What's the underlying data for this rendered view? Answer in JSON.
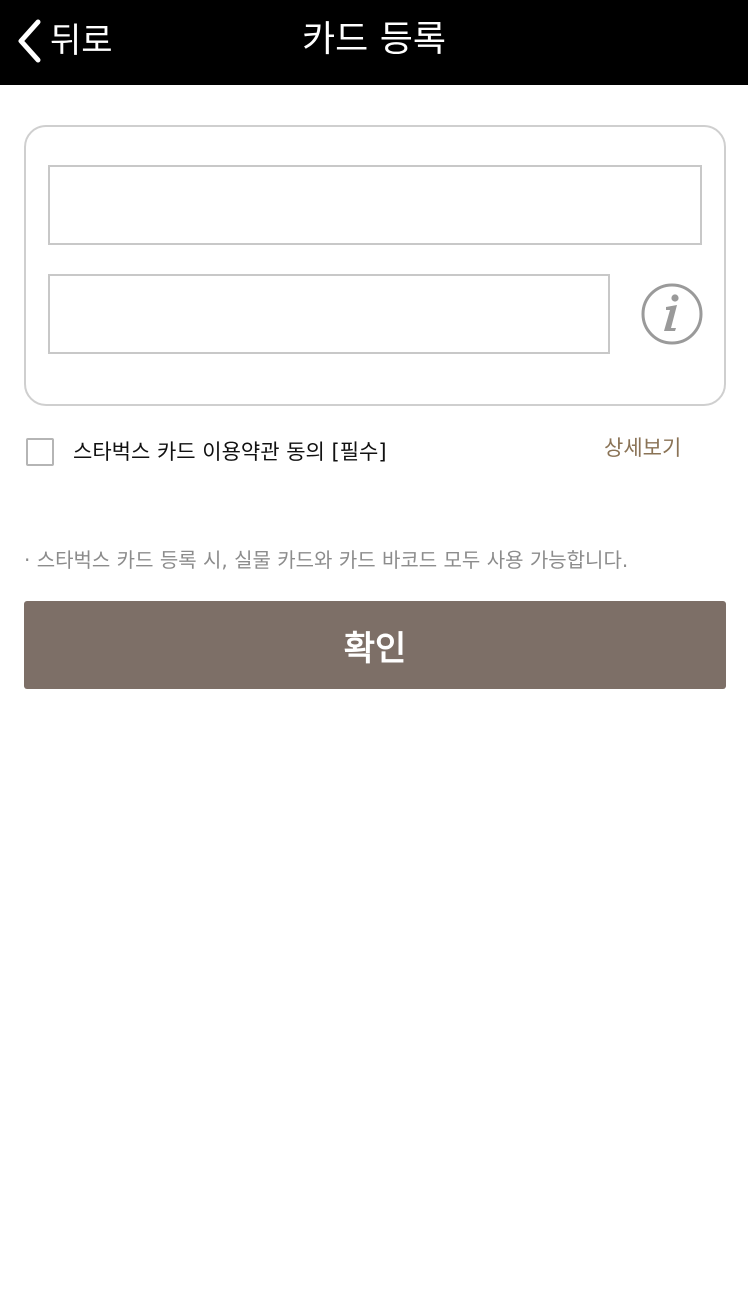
{
  "header": {
    "back_label": "뒤로",
    "title": "카드 등록",
    "back_icon": "chevron-left-icon"
  },
  "form": {
    "card_number": {
      "value": "",
      "placeholder": ""
    },
    "pin": {
      "value": "",
      "placeholder": ""
    },
    "info_icon": "info-icon"
  },
  "agreement": {
    "label": "스타벅스 카드 이용약관 동의 [필수]",
    "checked": false,
    "detail_label": "상세보기"
  },
  "notice": "· 스타벅스 카드 등록 시, 실물 카드와 카드 바코드 모두 사용 가능합니다.",
  "confirm_label": "확인",
  "colors": {
    "header_bg": "#000000",
    "accent_link": "#8a7356",
    "button_bg": "#7d6f67"
  }
}
